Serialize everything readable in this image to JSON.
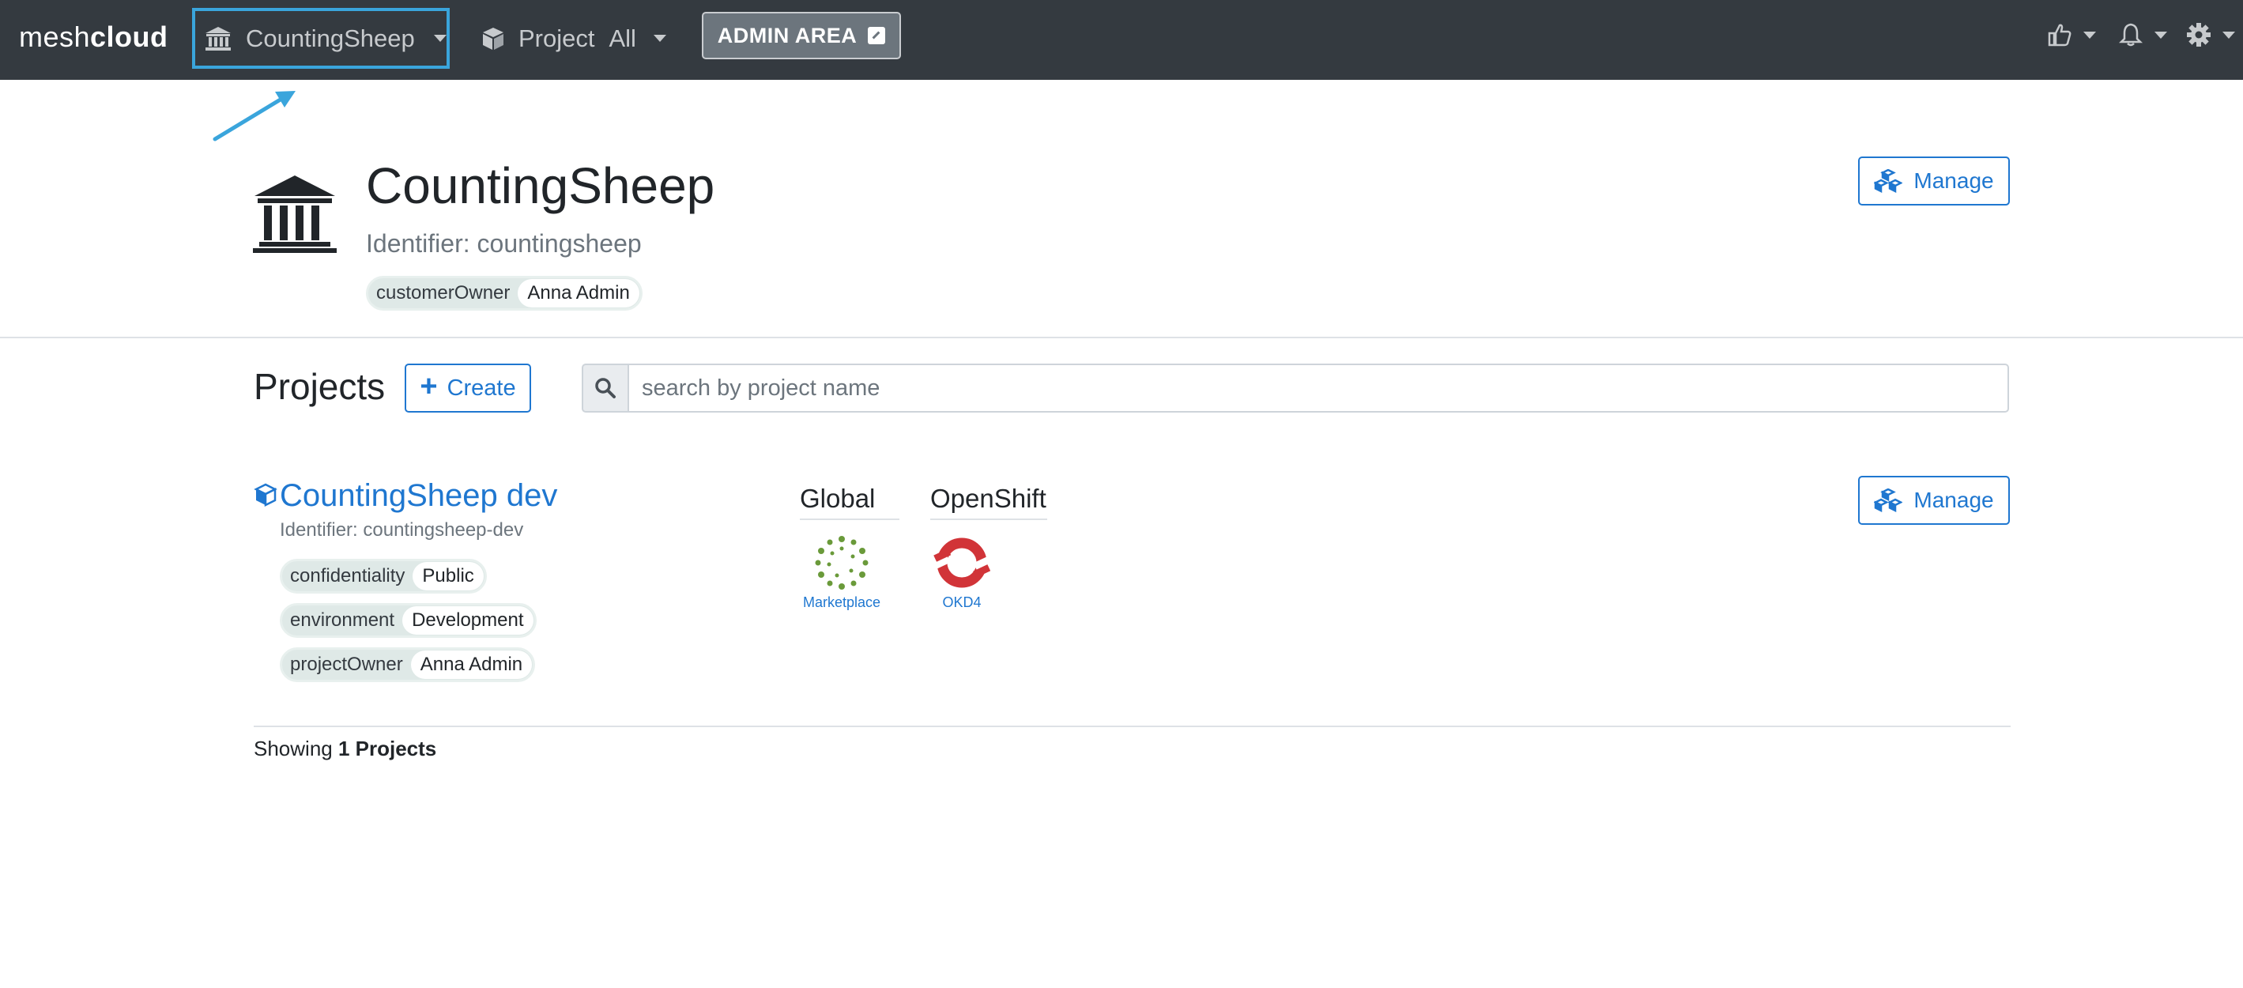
{
  "navbar": {
    "logo_part1": "mesh",
    "logo_part2": "cloud",
    "workspace_selector": "CountingSheep",
    "project_selector_label": "Project",
    "project_selector_value": "All",
    "admin_area": "ADMIN AREA"
  },
  "workspace": {
    "name": "CountingSheep",
    "identifier": "Identifier: countingsheep",
    "tags": [
      {
        "key": "customerOwner",
        "value": "Anna Admin"
      }
    ],
    "manage_label": "Manage"
  },
  "projects": {
    "heading": "Projects",
    "create_label": "Create",
    "search_placeholder": "search by project name",
    "items": [
      {
        "name": "CountingSheep dev",
        "identifier": "Identifier: countingsheep-dev",
        "tags": [
          {
            "key": "confidentiality",
            "value": "Public"
          },
          {
            "key": "environment",
            "value": "Development"
          },
          {
            "key": "projectOwner",
            "value": "Anna Admin"
          }
        ],
        "platform_groups": [
          {
            "heading": "Global",
            "platform": "Marketplace"
          },
          {
            "heading": "OpenShift",
            "platform": "OKD4"
          }
        ],
        "manage_label": "Manage"
      }
    ],
    "showing_prefix": "Showing",
    "showing_count": "1 Projects"
  },
  "colors": {
    "navbar_bg": "#343a40",
    "accent_blue": "#1f77d0",
    "highlight_border": "#3aa5dc",
    "tag_bg": "#dfe9e7",
    "okd_red": "#d13438",
    "marketplace_green": "#6a9a3a"
  },
  "icons": {
    "workspace": "bank-icon",
    "project": "cube-icon",
    "search": "search-icon",
    "manage": "cubes-icon",
    "feedback": "thumbs-up-icon",
    "notifications": "bell-icon",
    "settings": "gear-icon"
  }
}
